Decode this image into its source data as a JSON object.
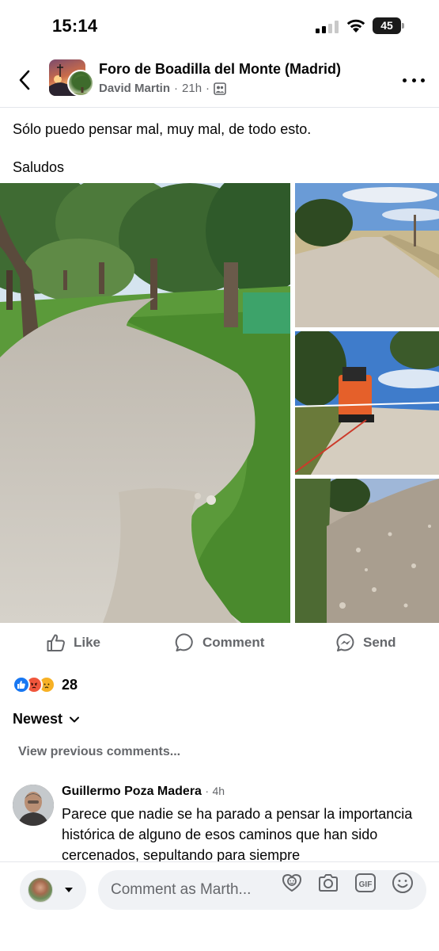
{
  "status_bar": {
    "time": "15:14",
    "battery": "45"
  },
  "header": {
    "group_name": "Foro de Boadilla del Monte (Madrid)",
    "author": "David Martin",
    "separator": "·",
    "time_ago": "21h",
    "audience_icon": "group-members-icon",
    "back_icon": "chevron-left-icon",
    "more_icon": "more-horizontal-icon"
  },
  "post": {
    "text_lines": [
      "Sólo puedo pensar mal, muy mal, de todo esto.",
      "Saludos"
    ],
    "photo_count": 4
  },
  "actions": {
    "like": "Like",
    "comment": "Comment",
    "send": "Send"
  },
  "reactions": {
    "types": [
      "like",
      "angry",
      "sad"
    ],
    "count": "28"
  },
  "comments_section": {
    "sort_label": "Newest",
    "view_previous": "View previous comments...",
    "comments": [
      {
        "author": "Guillermo Poza Madera",
        "separator": "·",
        "time_ago": "4h",
        "text": "Parece que nadie se ha parado a pensar la importancia histórica de alguno de esos caminos que han sido cercenados, sepultando para siempre"
      }
    ]
  },
  "composer": {
    "placeholder": "Comment as Marth...",
    "icons": [
      "avatar-sticker-icon",
      "camera-icon",
      "gif-icon",
      "emoji-icon"
    ]
  },
  "colors": {
    "text_primary": "#050505",
    "text_secondary": "#65676b",
    "like_blue": "#1877f2",
    "angry_red": "#f0563c",
    "sad_yellow": "#f7b125",
    "composer_bg": "#f0f2f5"
  }
}
